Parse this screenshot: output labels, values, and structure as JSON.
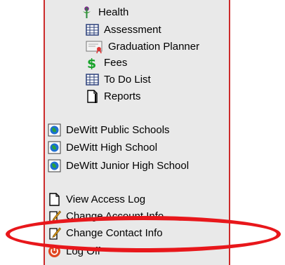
{
  "menu": {
    "items": [
      {
        "label": "Health",
        "icon": "health-icon"
      },
      {
        "label": "Assessment",
        "icon": "assessment-icon"
      },
      {
        "label": "Graduation Planner",
        "icon": "graduation-planner-icon"
      },
      {
        "label": "Fees",
        "icon": "fees-icon"
      },
      {
        "label": "To Do List",
        "icon": "todo-list-icon"
      },
      {
        "label": "Reports",
        "icon": "reports-icon"
      }
    ]
  },
  "schools": {
    "items": [
      {
        "label": "DeWitt Public Schools",
        "icon": "school-globe-icon"
      },
      {
        "label": "DeWitt High School",
        "icon": "school-globe-icon"
      },
      {
        "label": "DeWitt Junior High School",
        "icon": "school-globe-icon"
      }
    ]
  },
  "account": {
    "items": [
      {
        "label": "View Access Log",
        "icon": "document-icon"
      },
      {
        "label": "Change Account Info",
        "icon": "edit-icon"
      },
      {
        "label": "Change Contact Info",
        "icon": "edit-icon"
      },
      {
        "label": "Log Off",
        "icon": "power-icon"
      }
    ]
  },
  "colors": {
    "panel_bg": "#e9e9e9",
    "panel_border": "#cc2b2b",
    "highlight": "#e8171b"
  }
}
